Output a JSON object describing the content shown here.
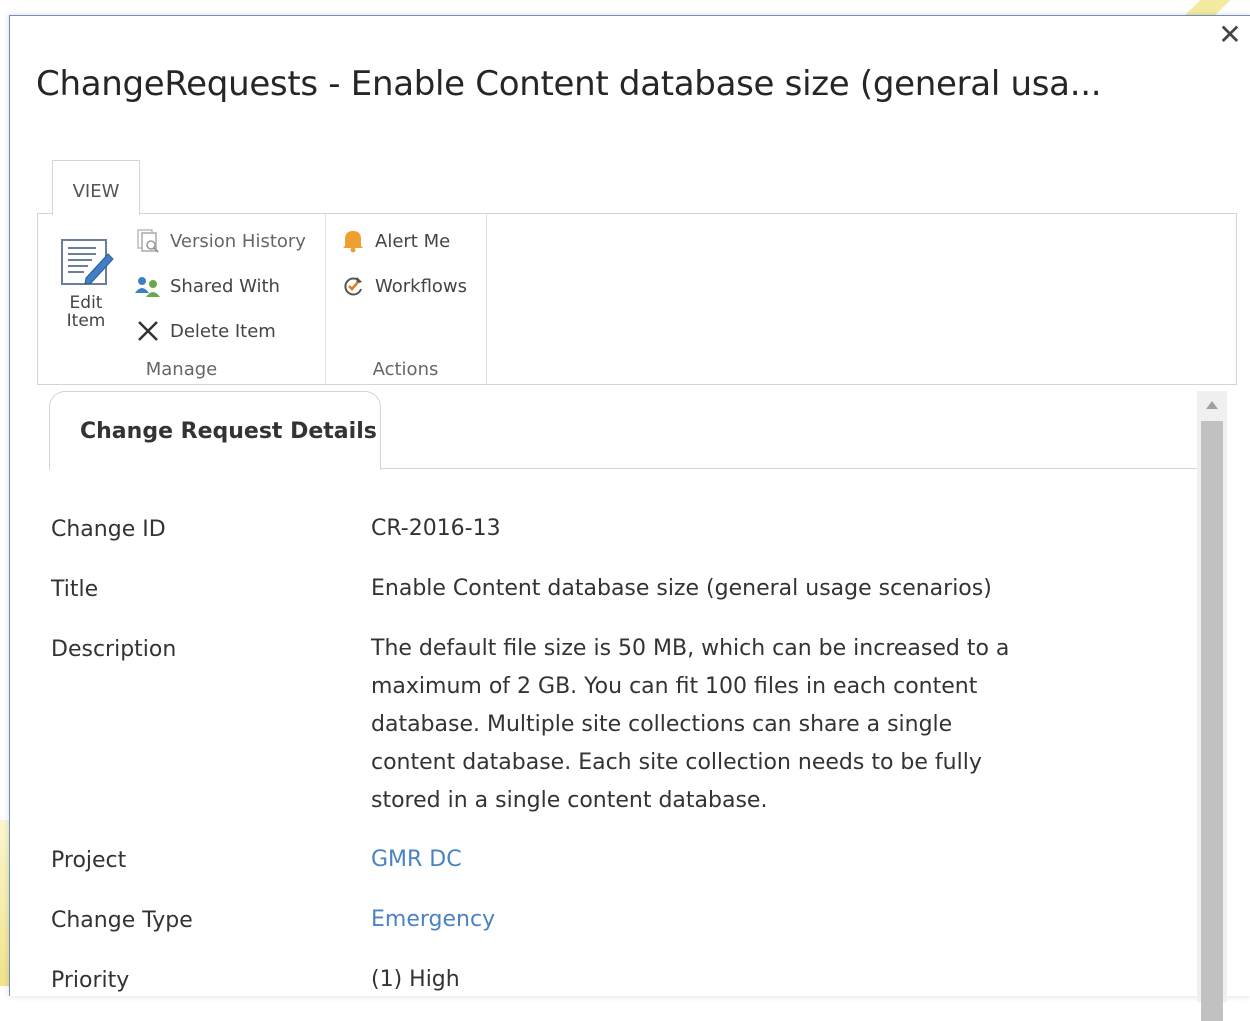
{
  "dialog": {
    "title": "ChangeRequests - Enable Content database size (general usa...",
    "close_glyph": "✕"
  },
  "ribbon": {
    "tab_label": "VIEW",
    "groups": {
      "manage": {
        "label": "Manage",
        "edit_item_line1": "Edit",
        "edit_item_line2": "Item",
        "version_history": "Version History",
        "shared_with": "Shared With",
        "delete_item": "Delete Item"
      },
      "actions": {
        "label": "Actions",
        "alert_me": "Alert Me",
        "workflows": "Workflows"
      }
    }
  },
  "details": {
    "section_title": "Change Request Details",
    "fields": {
      "change_id": {
        "label": "Change ID",
        "value": "CR-2016-13"
      },
      "title": {
        "label": "Title",
        "value": "Enable Content database size (general usage scenarios)"
      },
      "description": {
        "label": "Description",
        "value": "The default file size is 50 MB, which can be increased to a maximum of 2 GB. You can fit 100 files in each content database. Multiple site collections can share a single content database. Each site collection needs to be fully stored in a single content database."
      },
      "project": {
        "label": "Project",
        "value": "GMR DC"
      },
      "change_type": {
        "label": "Change Type",
        "value": "Emergency"
      },
      "priority": {
        "label": "Priority",
        "value": "(1) High"
      }
    }
  },
  "colors": {
    "link": "#4b83c0",
    "border": "#d4d4d4",
    "dialog_border": "#6c8fbf"
  },
  "icons": [
    "close-icon",
    "edit-item-icon",
    "version-history-icon",
    "shared-with-icon",
    "delete-icon",
    "alert-bell-icon",
    "workflow-icon",
    "scroll-up-arrow-icon"
  ]
}
